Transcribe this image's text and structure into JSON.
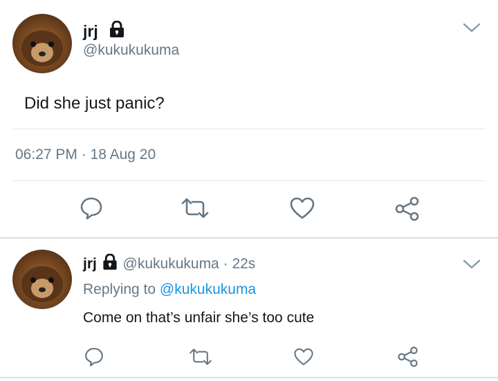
{
  "main_tweet": {
    "name": "jrj",
    "handle": "@kukukukuma",
    "text": "Did she just panic?",
    "timestamp": "06:27 PM · 18 Aug 20"
  },
  "reply_tweet": {
    "name": "jrj",
    "handle": "@kukukukuma",
    "separator": "·",
    "time_ago": "22s",
    "replying_label": "Replying to",
    "replying_to": "@kukukukuma",
    "text": "Come on that’s unfair she’s too cute"
  },
  "icons": {
    "protected": "lock-icon",
    "menu": "chevron-down-icon",
    "actions": [
      "reply-icon",
      "retweet-icon",
      "like-icon",
      "share-icon"
    ]
  },
  "colors": {
    "text": "#14171a",
    "secondary": "#657786",
    "link": "#1b95e0",
    "divider": "#e1e8ed"
  }
}
